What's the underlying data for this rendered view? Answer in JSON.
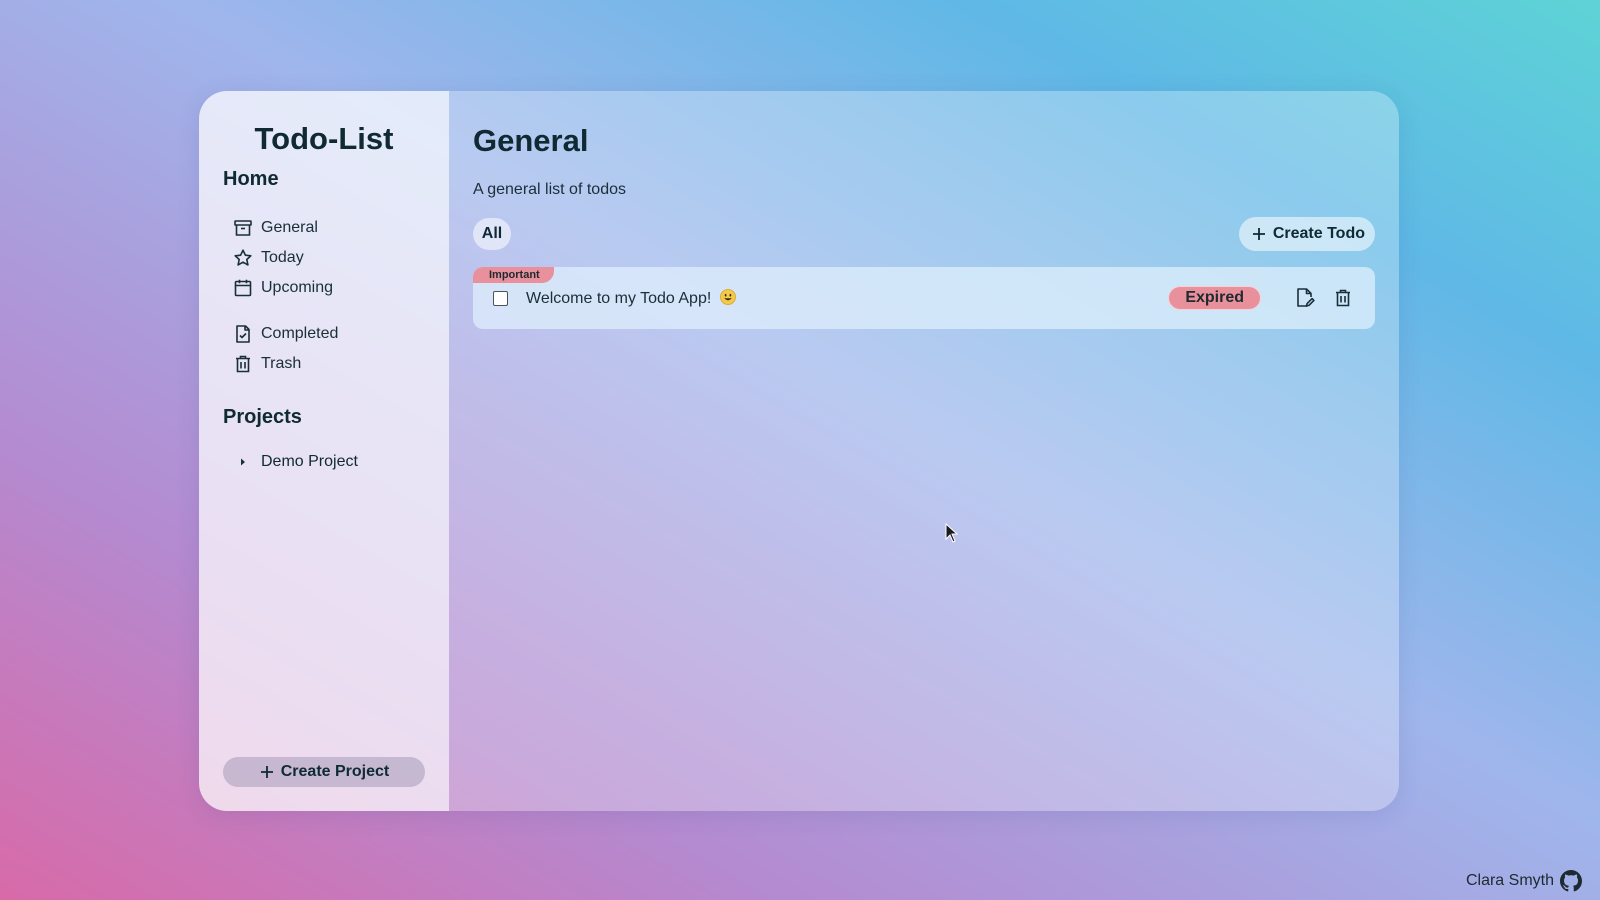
{
  "sidebar": {
    "app_title": "Todo-List",
    "home_heading": "Home",
    "nav": [
      {
        "label": "General",
        "icon": "archive-icon"
      },
      {
        "label": "Today",
        "icon": "star-icon"
      },
      {
        "label": "Upcoming",
        "icon": "calendar-icon"
      },
      {
        "label": "Completed",
        "icon": "file-check-icon"
      },
      {
        "label": "Trash",
        "icon": "trash-icon"
      }
    ],
    "projects_heading": "Projects",
    "projects": [
      {
        "label": "Demo Project",
        "icon": "caret-right-icon"
      }
    ],
    "create_project_label": "Create Project"
  },
  "main": {
    "title": "General",
    "description": "A general list of todos",
    "filter_label": "All",
    "create_todo_label": "Create Todo",
    "todos": [
      {
        "priority": "Important",
        "text": "Welcome to my Todo App!",
        "emoji": "😃",
        "status": "Expired",
        "completed": false
      }
    ]
  },
  "footer": {
    "author": "Clara Smyth",
    "icon": "github-icon"
  },
  "colors": {
    "tag_red": "#e8909c",
    "text_dark": "#0f2a33"
  }
}
